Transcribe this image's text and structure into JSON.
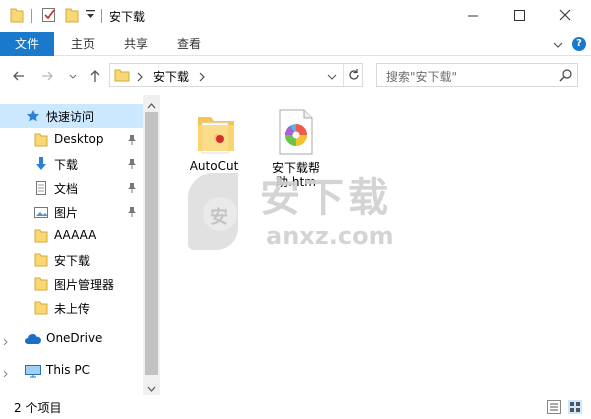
{
  "window": {
    "title": "安下载",
    "controls": [
      "minimize-icon",
      "maximize-icon",
      "close-icon"
    ]
  },
  "ribbon": {
    "file_tab": "文件",
    "tabs": [
      "主页",
      "共享",
      "查看"
    ],
    "help": "?"
  },
  "address_bar": {
    "path": "安下载",
    "search_placeholder": "搜索\"安下载\""
  },
  "nav_pane": {
    "items": [
      {
        "label": "快速访问",
        "icon": "star-icon",
        "selected": true
      },
      {
        "label": "Desktop",
        "icon": "folder-icon",
        "pinned": true
      },
      {
        "label": "下载",
        "icon": "download-icon",
        "pinned": true
      },
      {
        "label": "文档",
        "icon": "document-icon",
        "pinned": true
      },
      {
        "label": "图片",
        "icon": "pictures-icon",
        "pinned": true
      },
      {
        "label": "AAAAA",
        "icon": "folder-icon"
      },
      {
        "label": "安下载",
        "icon": "folder-icon"
      },
      {
        "label": "图片管理器",
        "icon": "folder-icon"
      },
      {
        "label": "未上传",
        "icon": "folder-icon"
      },
      {
        "label": "OneDrive",
        "icon": "cloud-icon"
      },
      {
        "label": "This PC",
        "icon": "computer-icon"
      }
    ]
  },
  "files": [
    {
      "name": "AutoCut",
      "icon": "folder-icon"
    },
    {
      "name_line1": "安下载帮",
      "name_line2": "助.htm",
      "icon": "html-file-icon"
    }
  ],
  "watermark": {
    "text": "安下载",
    "domain": "anxz.com",
    "badge": "安"
  },
  "status": {
    "text": "2 个项目"
  },
  "colors": {
    "accent": "#1979ca",
    "selected": "#cce8ff",
    "folder": "#f8d775"
  }
}
